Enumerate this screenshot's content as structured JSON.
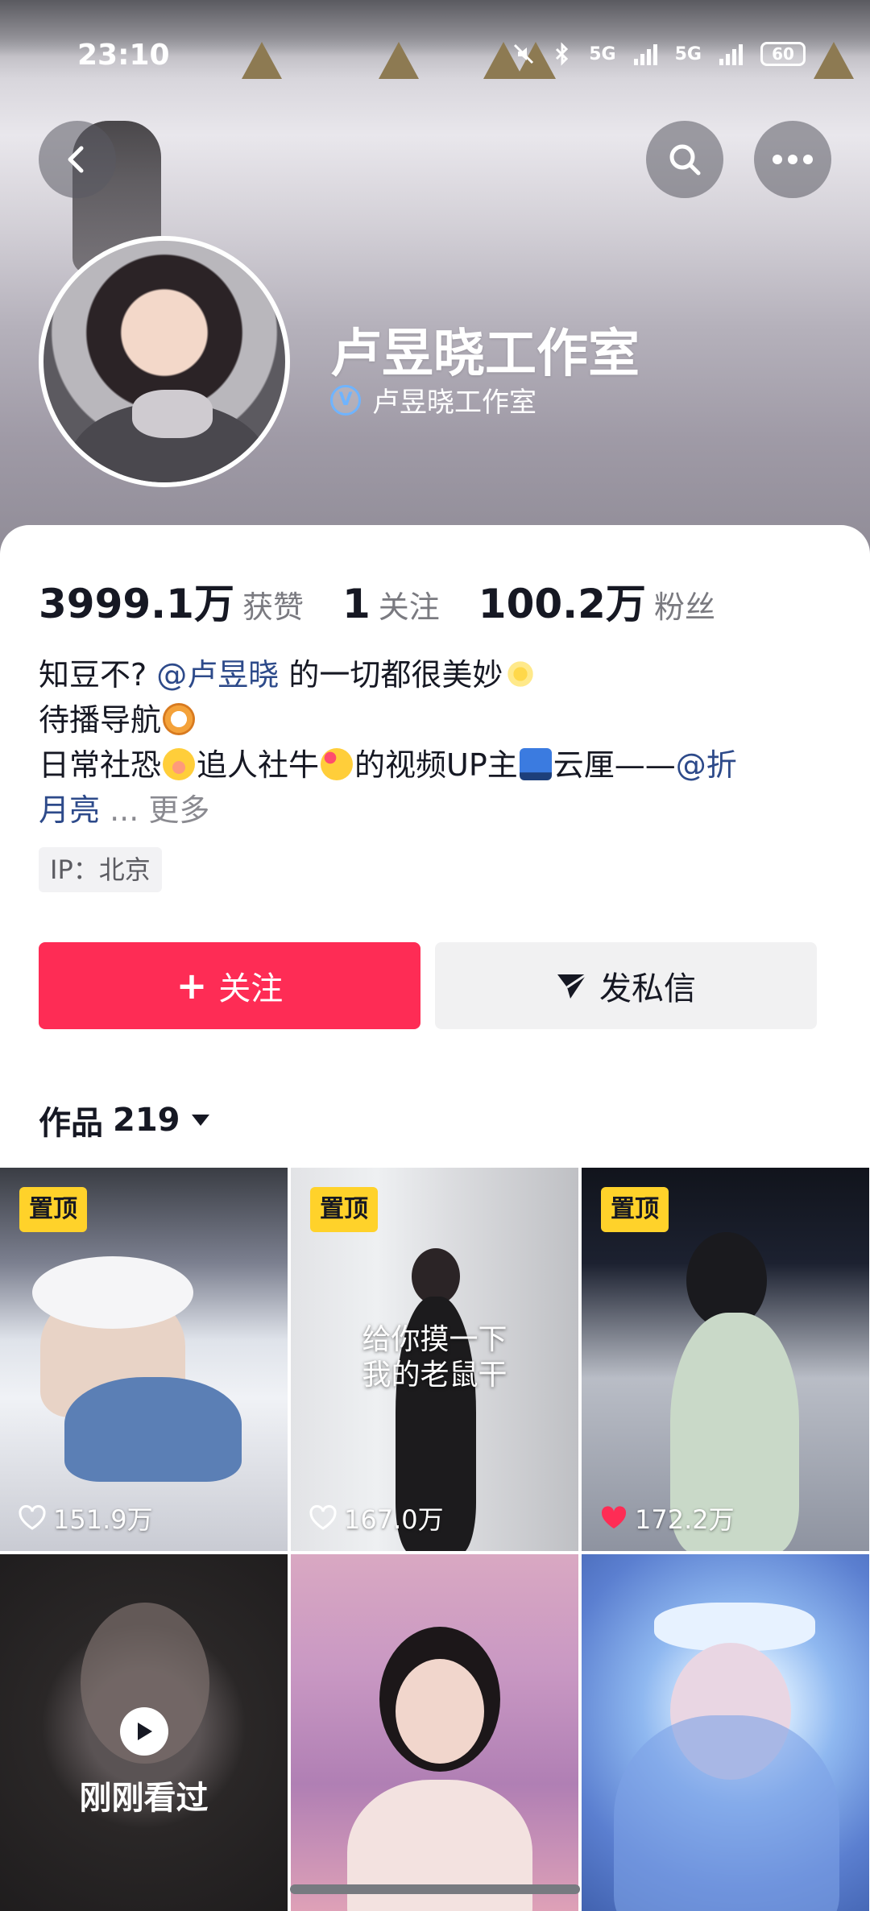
{
  "status_bar": {
    "time": "23:10",
    "network_1": "5G",
    "network_2": "5G",
    "battery": "60"
  },
  "header": {
    "back_icon": "chevron-left-icon",
    "search_icon": "search-icon",
    "more_icon": "more-horizontal-icon"
  },
  "profile": {
    "name": "卢昱晓工作室",
    "verified_badge": "V",
    "verified_text": "卢昱晓工作室"
  },
  "stats": [
    {
      "value": "3999.1万",
      "label": "获赞"
    },
    {
      "value": "1",
      "label": "关注"
    },
    {
      "value": "100.2万",
      "label": "粉丝"
    }
  ],
  "bio": {
    "line1_pre": "知豆不? ",
    "line1_mention": "@卢昱晓",
    "line1_post": " 的一切都很美妙",
    "line2": "待播导航",
    "line3_a": "日常社恐",
    "line3_b": "追人社牛",
    "line3_c": "的视频UP主",
    "line3_d": "云厘——",
    "line3_mention_a": "@折",
    "line4_mention_b": "月亮",
    "line4_ellipsis": " ... ",
    "more": "更多"
  },
  "ip_tag": "IP：北京",
  "buttons": {
    "follow": "关注",
    "follow_icon": "+",
    "message": "发私信"
  },
  "works": {
    "label": "作品",
    "count": "219"
  },
  "videos": [
    {
      "pinned": "置顶",
      "likes": "151.9万",
      "liked": false
    },
    {
      "pinned": "置顶",
      "likes": "167.0万",
      "liked": false,
      "caption_1": "给你摸一下",
      "caption_2": "我的老鼠干"
    },
    {
      "pinned": "置顶",
      "likes": "172.2万",
      "liked": true
    },
    {
      "watched": "刚刚看过"
    },
    {},
    {}
  ],
  "colors": {
    "accent": "#fe2c55",
    "pin": "#ffd22a",
    "mention": "#2d4a8a"
  }
}
